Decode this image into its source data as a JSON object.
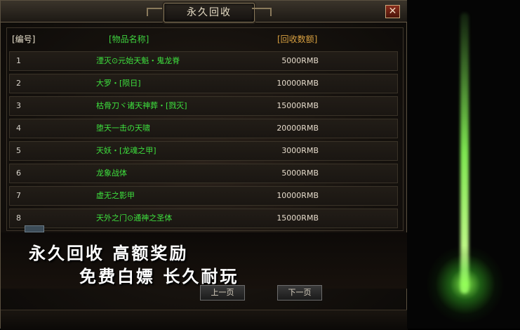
{
  "window": {
    "title": "永久回收",
    "close_label": "✕"
  },
  "table": {
    "headers": {
      "id": "[编号]",
      "name": "[物品名称]",
      "amount": "[回收数额]"
    },
    "rows": [
      {
        "id": "1",
        "name": "湮灭⊙元始天魁・鬼龙脊",
        "amount": "5000RMB"
      },
      {
        "id": "2",
        "name": "大罗・[陨日]",
        "amount": "10000RMB"
      },
      {
        "id": "3",
        "name": "枯骨刀ヾ诸天神葬・[戮灭]",
        "amount": "15000RMB"
      },
      {
        "id": "4",
        "name": "堕天一击の天啸",
        "amount": "20000RMB"
      },
      {
        "id": "5",
        "name": "天妖・[龙魂之甲]",
        "amount": "3000RMB"
      },
      {
        "id": "6",
        "name": "龙象战体",
        "amount": "5000RMB"
      },
      {
        "id": "7",
        "name": "虚无之影甲",
        "amount": "10000RMB"
      },
      {
        "id": "8",
        "name": "天外之门⊙通神之圣体",
        "amount": "15000RMB"
      }
    ]
  },
  "banner": {
    "line1": "永久回收 高额奖励",
    "line2": "免费白嫖 长久耐玩"
  },
  "pager": {
    "prev_label": "上一页",
    "next_label": "下一页"
  },
  "colors": {
    "item_name": "#3ee03e",
    "header_amount": "#d8a040",
    "accent_glow": "#8cff50"
  }
}
